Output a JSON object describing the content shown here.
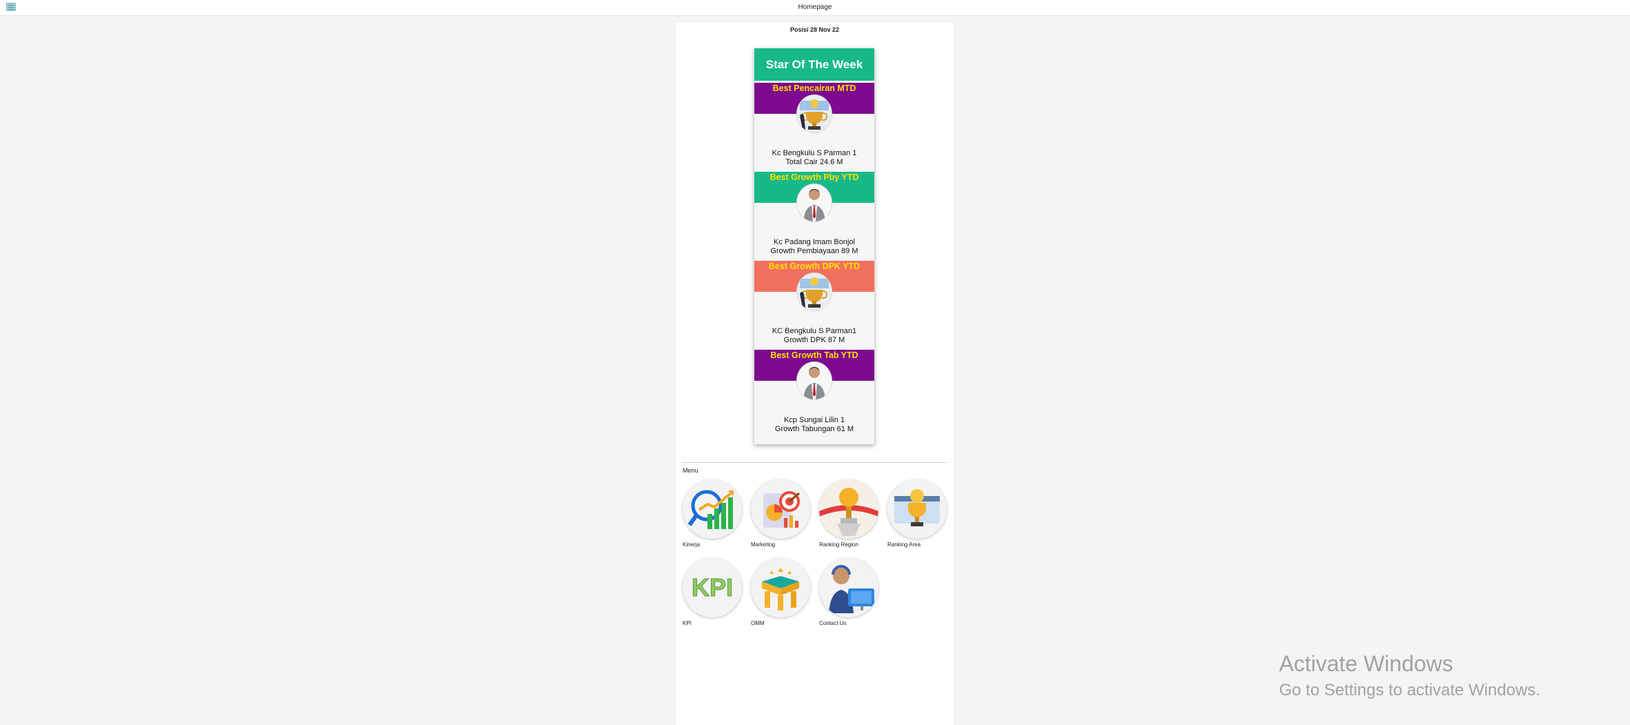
{
  "header": {
    "title": "Homepage"
  },
  "posisi": "Posisi 28 Nov 22",
  "star": {
    "title": "Star Of The Week",
    "awards": [
      {
        "title": "Best Pencairan MTD",
        "band_color": "#7e0a8f",
        "name": "Kc Bengkulu S Parman 1",
        "value": "Total Cair 24.6 M",
        "image": "trophy-icon"
      },
      {
        "title": "Best Growth Pby YTD",
        "band_color": "#17b987",
        "name": "Kc Padang Imam Bonjol",
        "value": "Growth Pembiayaan 89 M",
        "image": "person-photo"
      },
      {
        "title": "Best Growth DPK YTD",
        "band_color": "#f2705e",
        "name": "KC Bengkulu S Parman1",
        "value": "Growth DPK 87 M",
        "image": "trophy-icon"
      },
      {
        "title": "Best Growth Tab YTD",
        "band_color": "#7e0a8f",
        "name": "Kcp Sungai Lilin 1",
        "value": "Growth Tabungan 61 M",
        "image": "person-photo"
      }
    ]
  },
  "menu": {
    "label": "Menu",
    "items": [
      {
        "label": "Kinerja",
        "icon": "growth-chart-icon"
      },
      {
        "label": "Marketing",
        "icon": "marketing-target-icon"
      },
      {
        "label": "Ranking Region",
        "icon": "ranking-medal-icon"
      },
      {
        "label": "Ranking Area",
        "icon": "ranking-trophy-icon"
      },
      {
        "label": "KPI",
        "icon": "kpi-icon"
      },
      {
        "label": "OMM",
        "icon": "omm-box-icon"
      },
      {
        "label": "Contact Us",
        "icon": "customer-service-icon"
      }
    ]
  },
  "watermark": {
    "line1": "Activate Windows",
    "line2": "Go to Settings to activate Windows."
  }
}
